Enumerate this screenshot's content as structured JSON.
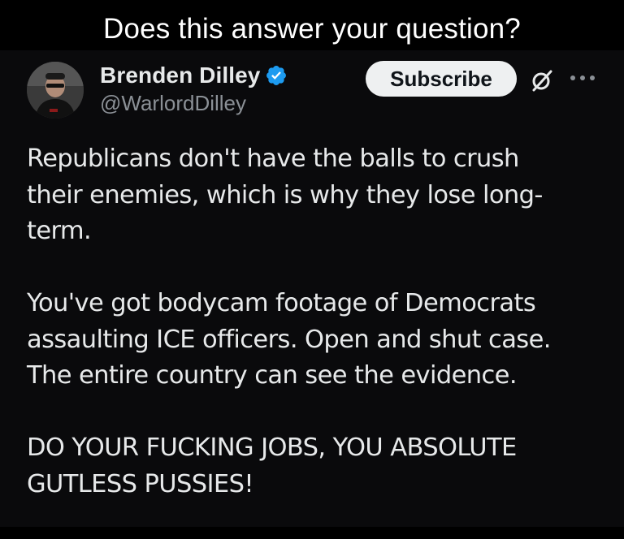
{
  "caption": "Does this answer your question?",
  "tweet": {
    "author": {
      "display_name": "Brenden Dilley",
      "handle": "@WarlordDilley",
      "verified": true,
      "verified_color": "#1d9bf0"
    },
    "subscribe_label": "Subscribe",
    "icons": {
      "grok": "grok-icon",
      "more": "more-icon"
    },
    "paragraphs": [
      "Republicans don't have the balls to crush\ntheir enemies, which is why they lose long-\nterm.",
      "You've got bodycam footage of Democrats\nassaulting ICE officers. Open and shut case.\nThe entire country can see the evidence.",
      "DO YOUR FUCKING JOBS, YOU ABSOLUTE\nGUTLESS PUSSIES!"
    ]
  },
  "colors": {
    "background": "#000000",
    "card": "#0a0a0c",
    "text": "#e7e9ea",
    "muted": "#8b9096",
    "button_bg": "#eef0f1"
  }
}
